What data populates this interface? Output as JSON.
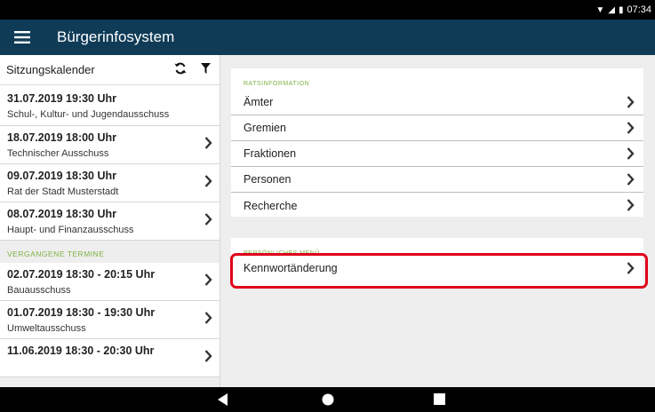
{
  "status_bar": {
    "time": "07:34",
    "icons": [
      "wifi-icon",
      "signal-icon",
      "battery-icon"
    ]
  },
  "app_bar": {
    "title": "Bürgerinfosystem",
    "icon": "menu-icon"
  },
  "sidebar": {
    "header": "Sitzungskalender",
    "header_icons": [
      "refresh-icon",
      "filter-icon"
    ],
    "upcoming": [
      {
        "datetime": "31.07.2019 19:30 Uhr",
        "committee": "Schul-, Kultur- und Jugendausschuss",
        "chevron": false
      },
      {
        "datetime": "18.07.2019 18:00 Uhr",
        "committee": "Technischer Ausschuss",
        "chevron": true
      },
      {
        "datetime": "09.07.2019 18:30 Uhr",
        "committee": "Rat der Stadt Musterstadt",
        "chevron": true
      },
      {
        "datetime": "08.07.2019 18:30 Uhr",
        "committee": "Haupt- und Finanzausschuss",
        "chevron": true
      }
    ],
    "past_label": "VERGANGENE TERMINE",
    "past": [
      {
        "datetime": "02.07.2019 18:30 - 20:15 Uhr",
        "committee": "Bauausschuss",
        "chevron": true
      },
      {
        "datetime": "01.07.2019 18:30 - 19:30 Uhr",
        "committee": "Umweltausschuss",
        "chevron": true
      },
      {
        "datetime": "11.06.2019 18:30 - 20:30 Uhr",
        "committee": "",
        "chevron": true
      }
    ]
  },
  "main": {
    "ratsinfo": {
      "label": "RATSINFORMATION",
      "items": [
        "Ämter",
        "Gremien",
        "Fraktionen",
        "Personen",
        "Recherche"
      ]
    },
    "personal": {
      "label": "PERSÖNLICHES MENÜ",
      "items": [
        "Kennwortänderung"
      ]
    }
  },
  "colors": {
    "app_bar": "#0f3b57",
    "section_label": "#7cb342",
    "highlight": "#e0001a"
  }
}
